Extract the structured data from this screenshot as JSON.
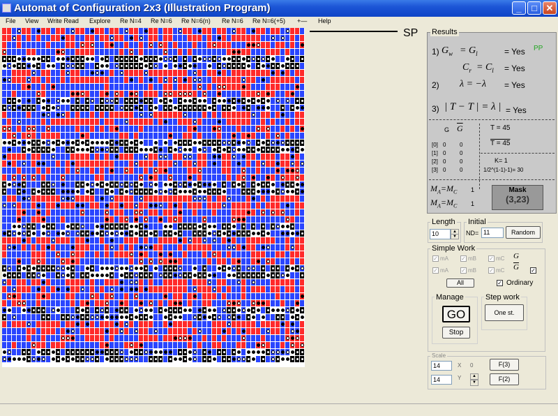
{
  "window": {
    "title": "Automat of Configuration 2x3 (Illustration Program)",
    "min": "_",
    "max": "□",
    "close": "✕"
  },
  "menu": [
    "File",
    "View",
    "Write Read",
    "Explore",
    "Re N=4",
    "Re N=6",
    "Re N=6(n)",
    "Re N=6",
    "Re N=6(+5)",
    "+—",
    "Help"
  ],
  "sp_label": "SP",
  "results": {
    "title": "Results",
    "row1_num": "1)",
    "row1_expr": "G",
    "row1_expr_sub": "w",
    "row1_eq": "= G",
    "row1_eq_sub": "l",
    "row1_val": "= Yes",
    "row1_badge": "PP",
    "row2_expr": "C",
    "row2_expr_sub": "r",
    "row2_eq": "= C",
    "row2_eq_sub": "l",
    "row2_val": "= Yes",
    "row3_num": "2)",
    "row3_expr": "λ = −λ",
    "row3_val": "= Yes",
    "row4_num": "3)",
    "row4_expr": "| T − T | = λ |",
    "row4_val": "= Yes",
    "col_g": "G",
    "col_gbar": "G",
    "t_label": "T = 45",
    "tbar_label": "T = 45",
    "rows": [
      {
        "label": "[0]",
        "a": "0",
        "b": "0"
      },
      {
        "label": "[1]",
        "a": "0",
        "b": "0"
      },
      {
        "label": "[2]",
        "a": "0",
        "b": "0"
      },
      {
        "label": "[3]",
        "a": "0",
        "b": "0"
      }
    ],
    "k_label": "K= 1",
    "k_sub": "1/2^(1-1)-1)= 30",
    "ma_label": "M",
    "ma_sub": "A",
    "ma_eq": "=M",
    "ma_eq_sub": "C",
    "ma_val": "1",
    "mb_label": "M",
    "mb_sub": "A",
    "mb_eq": "=M",
    "mb_eq_sub": "C",
    "mb_val": "1",
    "mask_label": "Mask",
    "mask_value": "(3,23)"
  },
  "length": {
    "title": "Length",
    "value": "10",
    "up": "▲",
    "down": "▼"
  },
  "initial": {
    "title": "Initial",
    "nd_label": "ND=",
    "nd_value": "11",
    "random_label": "Random"
  },
  "simple_work": {
    "title": "Simple Work",
    "checks": [
      {
        "label": "mA",
        "checked": "✓"
      },
      {
        "label": "mB",
        "checked": "✓"
      },
      {
        "label": "mC",
        "checked": "✓"
      },
      {
        "label": "mA",
        "checked": "✓"
      },
      {
        "label": "mB",
        "checked": "✓"
      },
      {
        "label": "mC",
        "checked": "✓"
      }
    ],
    "g_label": "G",
    "gbar_label": "G",
    "gbar_check": "✓",
    "all_label": "All",
    "ordinary_check": "✓",
    "ordinary_label": "Ordinary"
  },
  "manage": {
    "title": "Manage",
    "go_label": "GO",
    "stop_label": "Stop"
  },
  "step": {
    "title": "Step work",
    "one_label": "One st."
  },
  "scale": {
    "title": "Scale",
    "x_value": "14",
    "x_label": "X",
    "x_num": "0",
    "y_value": "14",
    "y_label": "Y",
    "f3_label": "F(3)",
    "f2_label": "F(2)",
    "up": "▲",
    "down": "▼"
  },
  "colors": {
    "red": "#ff2a2a",
    "blue": "#2a45ff",
    "black": "#000000",
    "white": "#ffffff"
  }
}
